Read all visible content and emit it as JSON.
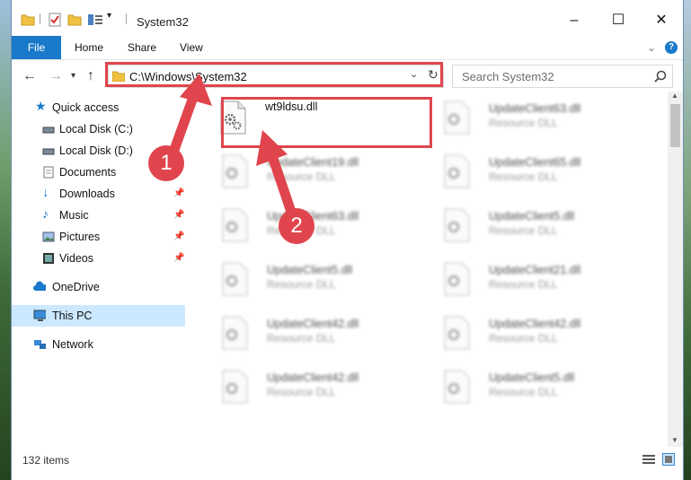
{
  "window": {
    "title": "System32",
    "minimize_glyph": "–",
    "maximize_glyph": "☐",
    "close_glyph": "✕"
  },
  "ribbon": {
    "file": "File",
    "tabs": [
      "Home",
      "Share",
      "View"
    ],
    "help_glyph": "?"
  },
  "address": {
    "path": "C:\\Windows\\System32",
    "search_placeholder": "Search System32"
  },
  "nav": {
    "items": [
      {
        "label": "Quick access",
        "icon": "star-icon"
      },
      {
        "label": "Local Disk (C:)",
        "icon": "drive-icon"
      },
      {
        "label": "Local Disk (D:)",
        "icon": "drive-icon"
      },
      {
        "label": "Documents",
        "icon": "documents-icon"
      },
      {
        "label": "Downloads",
        "icon": "download-icon"
      },
      {
        "label": "Music",
        "icon": "music-icon"
      },
      {
        "label": "Pictures",
        "icon": "pictures-icon"
      },
      {
        "label": "Videos",
        "icon": "videos-icon"
      },
      {
        "label": "OneDrive",
        "icon": "cloud-icon"
      },
      {
        "label": "This PC",
        "icon": "computer-icon"
      },
      {
        "label": "Network",
        "icon": "network-icon"
      }
    ]
  },
  "files": [
    {
      "name": "wt9ldsu.dll",
      "type": ""
    },
    {
      "name": "UpdateClient63.dll",
      "type": "Resource DLL"
    },
    {
      "name": "UpdateClient19.dll",
      "type": "Resource DLL"
    },
    {
      "name": "UpdateClient65.dll",
      "type": "Resource DLL"
    },
    {
      "name": "UpdateClient63.dll",
      "type": "Resource DLL"
    },
    {
      "name": "UpdateClient5.dll",
      "type": "Resource DLL"
    },
    {
      "name": "UpdateClient5.dll",
      "type": "Resource DLL"
    },
    {
      "name": "UpdateClient21.dll",
      "type": "Resource DLL"
    },
    {
      "name": "UpdateClient42.dll",
      "type": "Resource DLL"
    },
    {
      "name": "UpdateClient42.dll",
      "type": "Resource DLL"
    },
    {
      "name": "UpdateClient42.dll",
      "type": "Resource DLL"
    },
    {
      "name": "UpdateClient5.dll",
      "type": "Resource DLL"
    }
  ],
  "status": {
    "item_count": "132 items"
  },
  "annotations": {
    "step1": "1",
    "step2": "2",
    "color": "#e0454d"
  }
}
